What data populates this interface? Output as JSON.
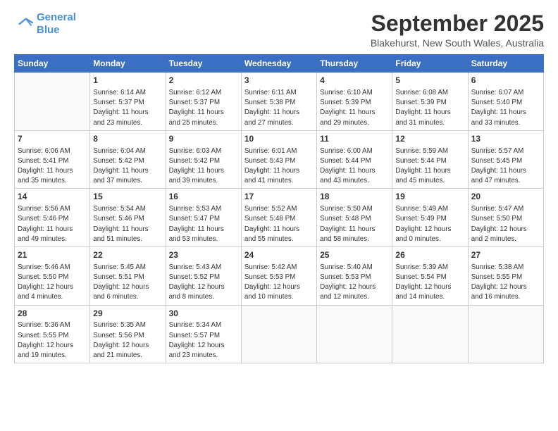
{
  "logo": {
    "line1": "General",
    "line2": "Blue"
  },
  "title": "September 2025",
  "location": "Blakehurst, New South Wales, Australia",
  "days_header": [
    "Sunday",
    "Monday",
    "Tuesday",
    "Wednesday",
    "Thursday",
    "Friday",
    "Saturday"
  ],
  "weeks": [
    [
      {
        "day": "",
        "text": ""
      },
      {
        "day": "1",
        "text": "Sunrise: 6:14 AM\nSunset: 5:37 PM\nDaylight: 11 hours\nand 23 minutes."
      },
      {
        "day": "2",
        "text": "Sunrise: 6:12 AM\nSunset: 5:37 PM\nDaylight: 11 hours\nand 25 minutes."
      },
      {
        "day": "3",
        "text": "Sunrise: 6:11 AM\nSunset: 5:38 PM\nDaylight: 11 hours\nand 27 minutes."
      },
      {
        "day": "4",
        "text": "Sunrise: 6:10 AM\nSunset: 5:39 PM\nDaylight: 11 hours\nand 29 minutes."
      },
      {
        "day": "5",
        "text": "Sunrise: 6:08 AM\nSunset: 5:39 PM\nDaylight: 11 hours\nand 31 minutes."
      },
      {
        "day": "6",
        "text": "Sunrise: 6:07 AM\nSunset: 5:40 PM\nDaylight: 11 hours\nand 33 minutes."
      }
    ],
    [
      {
        "day": "7",
        "text": "Sunrise: 6:06 AM\nSunset: 5:41 PM\nDaylight: 11 hours\nand 35 minutes."
      },
      {
        "day": "8",
        "text": "Sunrise: 6:04 AM\nSunset: 5:42 PM\nDaylight: 11 hours\nand 37 minutes."
      },
      {
        "day": "9",
        "text": "Sunrise: 6:03 AM\nSunset: 5:42 PM\nDaylight: 11 hours\nand 39 minutes."
      },
      {
        "day": "10",
        "text": "Sunrise: 6:01 AM\nSunset: 5:43 PM\nDaylight: 11 hours\nand 41 minutes."
      },
      {
        "day": "11",
        "text": "Sunrise: 6:00 AM\nSunset: 5:44 PM\nDaylight: 11 hours\nand 43 minutes."
      },
      {
        "day": "12",
        "text": "Sunrise: 5:59 AM\nSunset: 5:44 PM\nDaylight: 11 hours\nand 45 minutes."
      },
      {
        "day": "13",
        "text": "Sunrise: 5:57 AM\nSunset: 5:45 PM\nDaylight: 11 hours\nand 47 minutes."
      }
    ],
    [
      {
        "day": "14",
        "text": "Sunrise: 5:56 AM\nSunset: 5:46 PM\nDaylight: 11 hours\nand 49 minutes."
      },
      {
        "day": "15",
        "text": "Sunrise: 5:54 AM\nSunset: 5:46 PM\nDaylight: 11 hours\nand 51 minutes."
      },
      {
        "day": "16",
        "text": "Sunrise: 5:53 AM\nSunset: 5:47 PM\nDaylight: 11 hours\nand 53 minutes."
      },
      {
        "day": "17",
        "text": "Sunrise: 5:52 AM\nSunset: 5:48 PM\nDaylight: 11 hours\nand 55 minutes."
      },
      {
        "day": "18",
        "text": "Sunrise: 5:50 AM\nSunset: 5:48 PM\nDaylight: 11 hours\nand 58 minutes."
      },
      {
        "day": "19",
        "text": "Sunrise: 5:49 AM\nSunset: 5:49 PM\nDaylight: 12 hours\nand 0 minutes."
      },
      {
        "day": "20",
        "text": "Sunrise: 5:47 AM\nSunset: 5:50 PM\nDaylight: 12 hours\nand 2 minutes."
      }
    ],
    [
      {
        "day": "21",
        "text": "Sunrise: 5:46 AM\nSunset: 5:50 PM\nDaylight: 12 hours\nand 4 minutes."
      },
      {
        "day": "22",
        "text": "Sunrise: 5:45 AM\nSunset: 5:51 PM\nDaylight: 12 hours\nand 6 minutes."
      },
      {
        "day": "23",
        "text": "Sunrise: 5:43 AM\nSunset: 5:52 PM\nDaylight: 12 hours\nand 8 minutes."
      },
      {
        "day": "24",
        "text": "Sunrise: 5:42 AM\nSunset: 5:53 PM\nDaylight: 12 hours\nand 10 minutes."
      },
      {
        "day": "25",
        "text": "Sunrise: 5:40 AM\nSunset: 5:53 PM\nDaylight: 12 hours\nand 12 minutes."
      },
      {
        "day": "26",
        "text": "Sunrise: 5:39 AM\nSunset: 5:54 PM\nDaylight: 12 hours\nand 14 minutes."
      },
      {
        "day": "27",
        "text": "Sunrise: 5:38 AM\nSunset: 5:55 PM\nDaylight: 12 hours\nand 16 minutes."
      }
    ],
    [
      {
        "day": "28",
        "text": "Sunrise: 5:36 AM\nSunset: 5:55 PM\nDaylight: 12 hours\nand 19 minutes."
      },
      {
        "day": "29",
        "text": "Sunrise: 5:35 AM\nSunset: 5:56 PM\nDaylight: 12 hours\nand 21 minutes."
      },
      {
        "day": "30",
        "text": "Sunrise: 5:34 AM\nSunset: 5:57 PM\nDaylight: 12 hours\nand 23 minutes."
      },
      {
        "day": "",
        "text": ""
      },
      {
        "day": "",
        "text": ""
      },
      {
        "day": "",
        "text": ""
      },
      {
        "day": "",
        "text": ""
      }
    ]
  ]
}
